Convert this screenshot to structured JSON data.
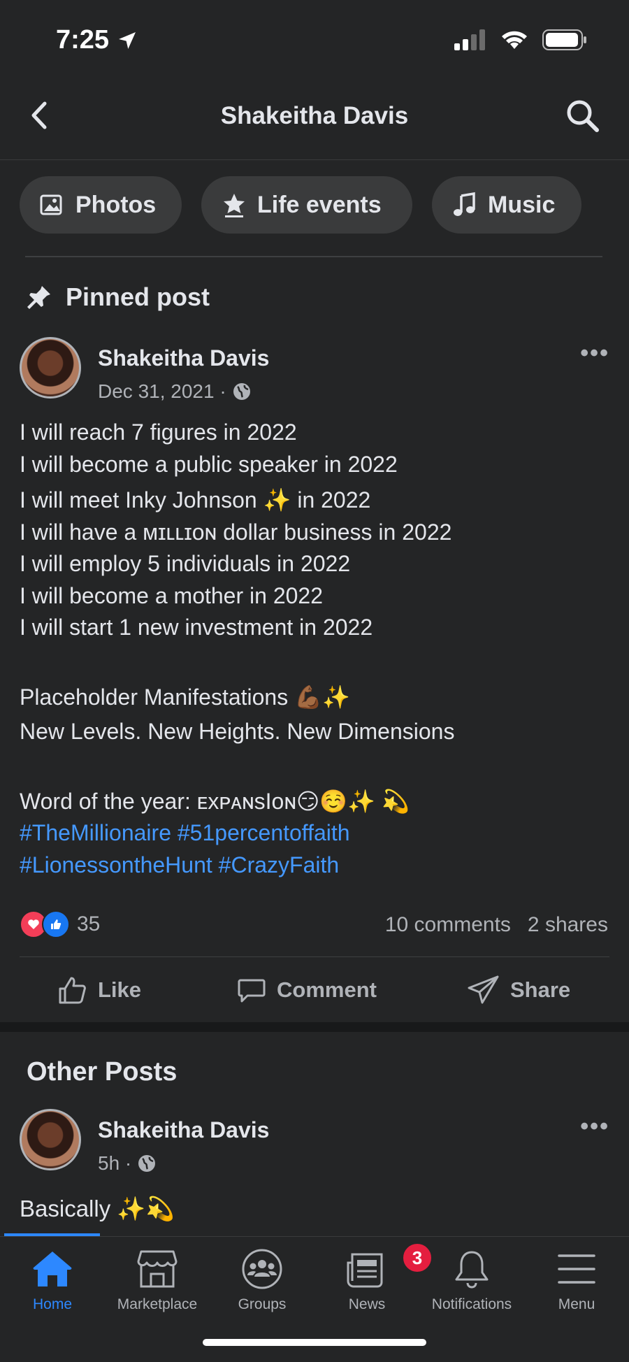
{
  "status": {
    "time": "7:25"
  },
  "header": {
    "title": "Shakeitha Davis"
  },
  "chips": [
    {
      "label": "Photos",
      "icon": "photos-icon"
    },
    {
      "label": "Life events",
      "icon": "star-icon"
    },
    {
      "label": "Music",
      "icon": "music-note-icon"
    }
  ],
  "pinned": {
    "heading": "Pinned post",
    "author": "Shakeitha Davis",
    "date": "Dec 31, 2021 ·",
    "lines": [
      "I will reach 7 figures in 2022",
      "I will become a public speaker in 2022",
      "I will meet Inky Johnson ✨ in 2022",
      "I will have a ᴍɪʟʟɪᴏɴ dollar business in 2022",
      "I will employ 5 individuals in 2022",
      "I will become a mother in 2022",
      "I will start 1 new investment in 2022",
      "Placeholder Manifestations 💪🏾✨",
      "New Levels. New Heights. New Dimensions",
      "Word of the year: ᴇxᴘᴀɴsIᴏɴ😏☺️✨ 💫"
    ],
    "hashtags": [
      "#TheMillionaire #51percentoffaith",
      "#LionessontheHunt #CrazyFaith"
    ],
    "reaction_count": "35",
    "comments": "10 comments",
    "shares": "2 shares",
    "actions": {
      "like": "Like",
      "comment": "Comment",
      "share": "Share"
    }
  },
  "other": {
    "heading": "Other Posts",
    "author": "Shakeitha Davis",
    "time": "5h ·",
    "text": "Basically ✨💫"
  },
  "nav": {
    "items": [
      {
        "label": "Home"
      },
      {
        "label": "Marketplace"
      },
      {
        "label": "Groups"
      },
      {
        "label": "News",
        "badge": "3"
      },
      {
        "label": "Notifications"
      },
      {
        "label": "Menu"
      }
    ]
  },
  "colors": {
    "accent": "#2d88ff",
    "hashtag": "#4599ff",
    "badge": "#e41e3f",
    "background": "#242526"
  }
}
